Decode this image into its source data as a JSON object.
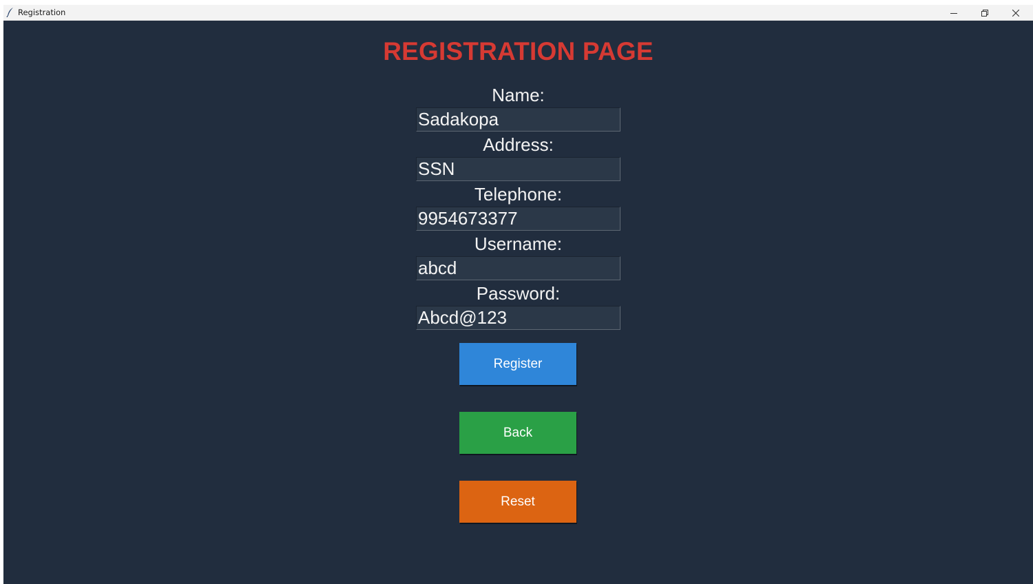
{
  "window": {
    "title": "Registration",
    "icon": "feather-icon",
    "controls": [
      "minimize-icon",
      "restore-icon",
      "close-icon"
    ]
  },
  "page": {
    "title": "REGISTRATION PAGE",
    "title_color": "#d63a33",
    "background": "#212d3e"
  },
  "form": {
    "name": {
      "label": "Name:",
      "value": "Sadakopa"
    },
    "address": {
      "label": "Address:",
      "value": "SSN"
    },
    "telephone": {
      "label": "Telephone:",
      "value": "9954673377"
    },
    "username": {
      "label": "Username:",
      "value": "abcd"
    },
    "password": {
      "label": "Password:",
      "value": "Abcd@123"
    }
  },
  "buttons": {
    "register": {
      "label": "Register",
      "color": "#2f86d9"
    },
    "back": {
      "label": "Back",
      "color": "#2aa046"
    },
    "reset": {
      "label": "Reset",
      "color": "#dc6412"
    }
  }
}
